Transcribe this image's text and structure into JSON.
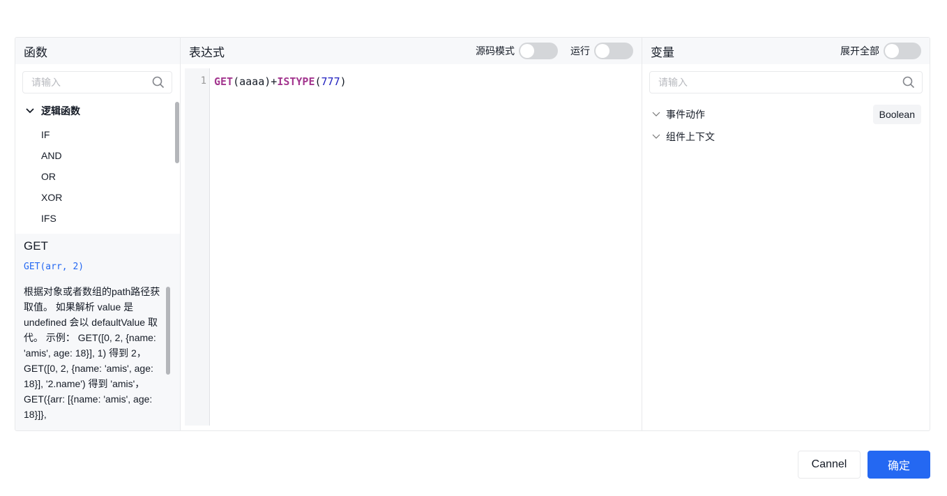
{
  "functions": {
    "title": "函数",
    "search_placeholder": "请输入",
    "group": "逻辑函数",
    "items": [
      "IF",
      "AND",
      "OR",
      "XOR",
      "IFS"
    ],
    "detail": {
      "name": "GET",
      "signature": "GET(arr, 2)",
      "description": "根据对象或者数组的path路径获取值。 如果解析 value 是 undefined 会以 defaultValue 取代。 示例： GET([0, 2, {name: 'amis', age: 18}], 1) 得到 2， GET([0, 2, {name: 'amis', age: 18}], '2.name') 得到 'amis'， GET({arr: [{name: 'amis', age: 18}]},"
    }
  },
  "expression": {
    "title": "表达式",
    "source_mode_label": "源码模式",
    "run_label": "运行",
    "line_number": "1",
    "code": {
      "fn1": "GET",
      "arg1": "(aaaa)+",
      "fn2": "ISTYPE",
      "p1": "(",
      "num": "777",
      "p2": ")"
    }
  },
  "variables": {
    "title": "变量",
    "expand_all_label": "展开全部",
    "search_placeholder": "请输入",
    "items": [
      {
        "label": "事件动作",
        "type": "Boolean"
      },
      {
        "label": "组件上下文"
      }
    ]
  },
  "footer": {
    "cancel": "Cannel",
    "confirm": "确定"
  },
  "colors": {
    "primary": "#2468f2"
  }
}
